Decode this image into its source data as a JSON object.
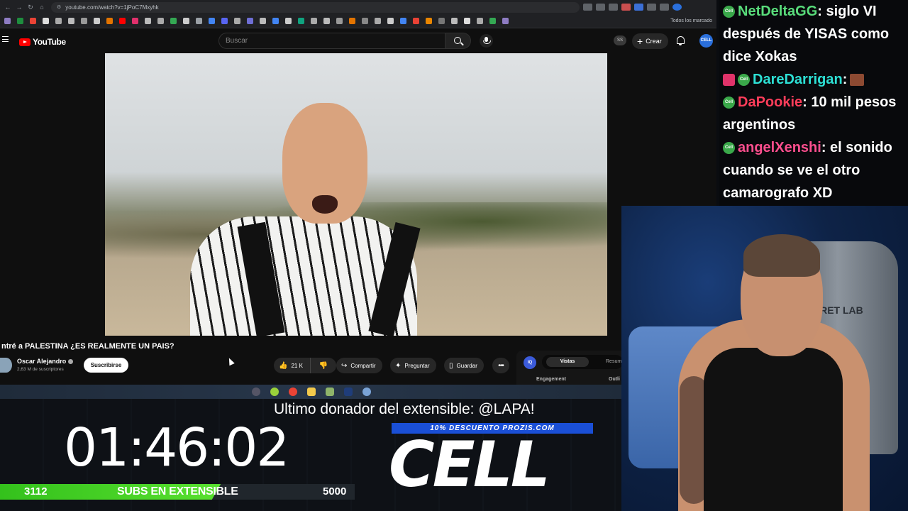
{
  "browser": {
    "url": "youtube.com/watch?v=1jPoC7Mxyhk",
    "bookmarks_all_label": "Todos los marcado"
  },
  "youtube": {
    "logo_text": "YouTube",
    "search_placeholder": "Buscar",
    "ss_badge": "SS",
    "create_label": "Crear",
    "video": {
      "title": "ntré a PALESTINA ¿ES REALMENTE UN PAIS?",
      "channel_name": "Oscar Alejandro",
      "subscribers": "2,63 M de suscriptores",
      "subscribe_label": "Suscribirse",
      "likes": "21 K",
      "share_label": "Compartir",
      "ask_label": "Preguntar",
      "save_label": "Guardar"
    },
    "side_panel": {
      "logo": "IQ",
      "tab_active": "Vistas",
      "tab_other": "Resum",
      "metric_1": "Engagement",
      "metric_2": "Outli"
    }
  },
  "stream_overlay": {
    "last_donor": "Ultimo donador del extensible: @LAPA!",
    "sponsor_banner": "10% DESCUENTO PROZIS.COM",
    "brand": "CELL",
    "timer": "01:46:02",
    "subs_current": "3112",
    "subs_label": "SUBS EN EXTENSIBLE",
    "subs_goal": "5000",
    "subs_progress": 0.6224
  },
  "chat": {
    "messages": [
      {
        "user": "NetDeltaGG",
        "text": ": siglo VI después de YISAS como dice Xokas"
      },
      {
        "user": "DareDarrigan",
        "text": ":"
      },
      {
        "user": "DaPookie",
        "text": ": 10 mil pesos argentinos"
      },
      {
        "user": "angelXenshi",
        "text": ": el sonido cuando se ve el otro camarografo XD"
      }
    ]
  },
  "webcam": {
    "chair_logo": "CRET LAB"
  },
  "colors": {
    "youtube_red": "#ff0000",
    "subs_bar_green": "#4fd228",
    "sponsor_blue": "#1a4fd6",
    "user_green": "#59dd7b",
    "user_cyan": "#2de0d5",
    "user_red": "#ff3d5a",
    "user_pink": "#ff4f8f"
  }
}
